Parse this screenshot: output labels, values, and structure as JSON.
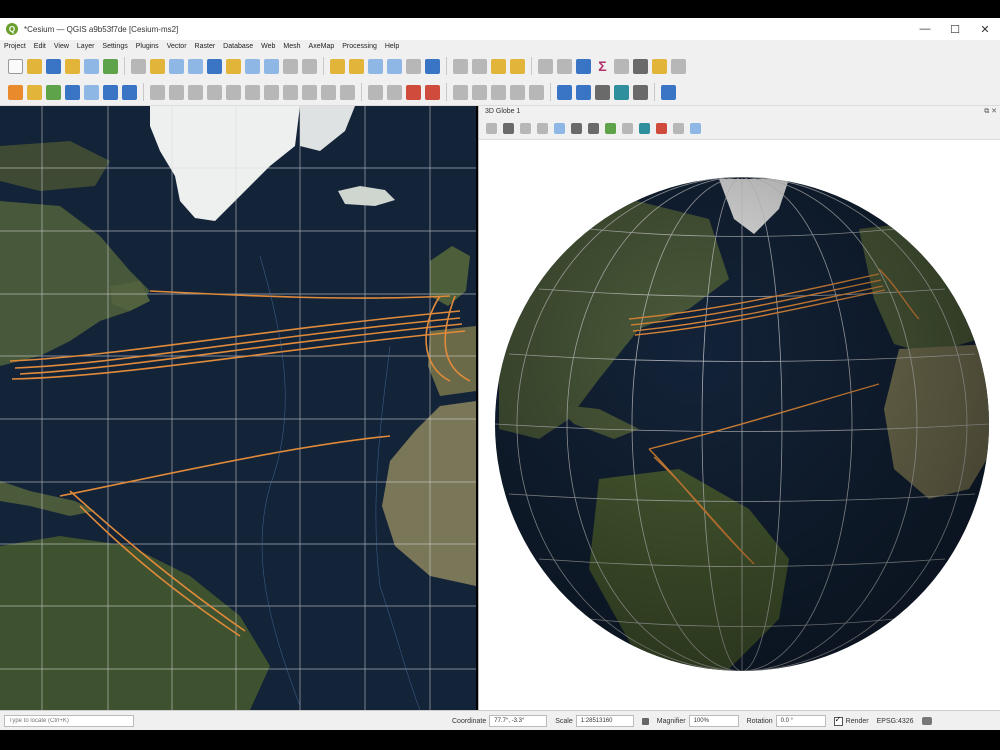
{
  "window": {
    "title": "*Cesium — QGIS a9b53f7de [Cesium-ms2]",
    "controls": {
      "minimize": "—",
      "maximize": "☐",
      "close": "✕"
    }
  },
  "menu": [
    "Project",
    "Edit",
    "View",
    "Layer",
    "Settings",
    "Plugins",
    "Vector",
    "Raster",
    "Database",
    "Web",
    "Mesh",
    "AxeMap",
    "Processing",
    "Help"
  ],
  "toolbar": {
    "sigma": "Σ"
  },
  "panel3d": {
    "title": "3D Globe 1",
    "controls": "⧉ ✕"
  },
  "statusbar": {
    "locate_placeholder": "Type to locate (Ctrl+K)",
    "coordinate_label": "Coordinate",
    "coordinate_value": "77.7°, -3.3°",
    "scale_label": "Scale",
    "scale_value": "1:28513160",
    "magnifier_label": "Magnifier",
    "magnifier_value": "100%",
    "rotation_label": "Rotation",
    "rotation_value": "0.0 °",
    "render_label": "Render",
    "crs_value": "EPSG:4326"
  },
  "colors": {
    "ocean": "#132338",
    "land": "#4a5a34",
    "ice": "#f2f2f2",
    "route": "#e08a3a",
    "grid": "#d8d8d8"
  }
}
